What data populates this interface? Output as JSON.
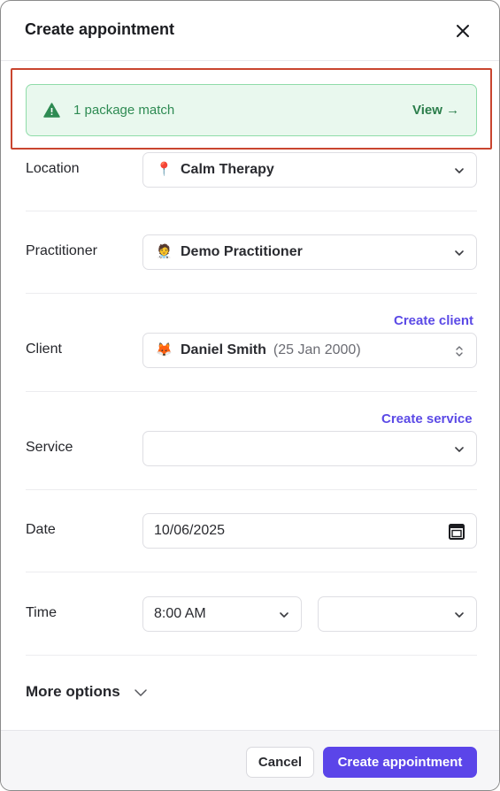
{
  "dialog": {
    "title": "Create appointment",
    "close_icon": "close-icon"
  },
  "alert": {
    "icon": "warning-triangle-icon",
    "text": "1 package match",
    "link": "View →",
    "color": "#2e8b53"
  },
  "fields": {
    "location": {
      "label": "Location",
      "icon": "map-pin-icon",
      "emoji": "📍",
      "value": "Calm Therapy"
    },
    "practitioner": {
      "label": "Practitioner",
      "icon": "practitioner-avatar-icon",
      "emoji": "🧑‍⚕️",
      "value": "Demo Practitioner"
    },
    "client": {
      "label": "Client",
      "icon": "client-avatar-icon",
      "emoji": "🦊",
      "value": "Daniel Smith",
      "dob": "(25 Jan 2000)",
      "create_link": "Create client"
    },
    "service": {
      "label": "Service",
      "value": "",
      "create_link": "Create service"
    },
    "date": {
      "label": "Date",
      "value": "10/06/2025",
      "icon": "calendar-icon"
    },
    "time": {
      "label": "Time",
      "start": "8:00 AM",
      "end": ""
    }
  },
  "more_options": "More options",
  "footer": {
    "cancel": "Cancel",
    "create": "Create appointment"
  },
  "colors": {
    "accent": "#5b45e9",
    "link": "#5b4ae6",
    "alert_bg": "#e9f8ee",
    "alert_border": "#8fdca9",
    "highlight": "#c9452f"
  }
}
